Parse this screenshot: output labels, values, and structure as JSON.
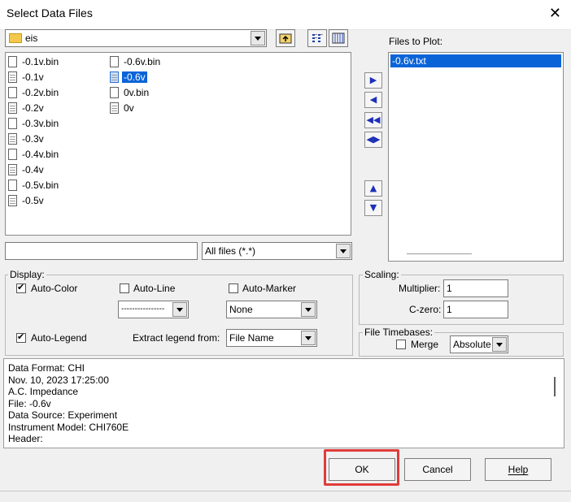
{
  "window": {
    "title": "Select Data Files",
    "close_glyph": "✕"
  },
  "folder_combo": {
    "value": "eis"
  },
  "toolbar": {
    "up_icon": "folder-up-icon",
    "list_view_icon": "list-view-icon",
    "details_view_icon": "details-view-icon"
  },
  "files_col1": [
    "-0.1v.bin",
    "-0.1v",
    "-0.2v.bin",
    "-0.2v",
    "-0.3v.bin",
    "-0.3v",
    "-0.4v.bin",
    "-0.4v",
    "-0.5v.bin",
    "-0.5v"
  ],
  "files_col2": [
    "-0.6v.bin",
    "-0.6v",
    "0v.bin",
    "0v"
  ],
  "selected_file": "-0.6v",
  "file_name_input": {
    "value": ""
  },
  "file_type_combo": {
    "value": "All files (*.*)"
  },
  "files_to_plot": {
    "label": "Files to Plot:",
    "items": [
      "-0.6v.txt"
    ]
  },
  "arrow_buttons": {
    "add": "▶",
    "remove": "◀",
    "remove_all": "◀◀",
    "swap": "◀▶",
    "up": "▲",
    "down": "▼"
  },
  "display": {
    "label": "Display:",
    "auto_color": {
      "label": "Auto-Color",
      "checked": true
    },
    "auto_line": {
      "label": "Auto-Line",
      "checked": false
    },
    "auto_marker": {
      "label": "Auto-Marker",
      "checked": false
    },
    "line_combo": "----------------",
    "marker_combo": "None",
    "auto_legend": {
      "label": "Auto-Legend",
      "checked": true
    },
    "extract_legend_label": "Extract legend from:",
    "extract_legend_combo": "File Name"
  },
  "scaling": {
    "label": "Scaling:",
    "multiplier_label": "Multiplier:",
    "multiplier_value": "1",
    "czero_label": "C-zero:",
    "czero_value": "1"
  },
  "timebases": {
    "label": "File Timebases:",
    "merge_label": "Merge",
    "merge_checked": false,
    "mode_combo": "Absolute"
  },
  "info": {
    "lines": [
      "Data Format: CHI",
      "Nov. 10, 2023   17:25:00",
      "A.C. Impedance",
      "File: -0.6v",
      "Data Source:  Experiment",
      "Instrument Model:  CHI760E",
      "Header:"
    ]
  },
  "buttons": {
    "ok": "OK",
    "cancel": "Cancel",
    "help": "Help"
  },
  "colors": {
    "selection": "#0a64d8",
    "highlight_frame": "#e03b3b",
    "arrow": "#1e2fb8"
  }
}
